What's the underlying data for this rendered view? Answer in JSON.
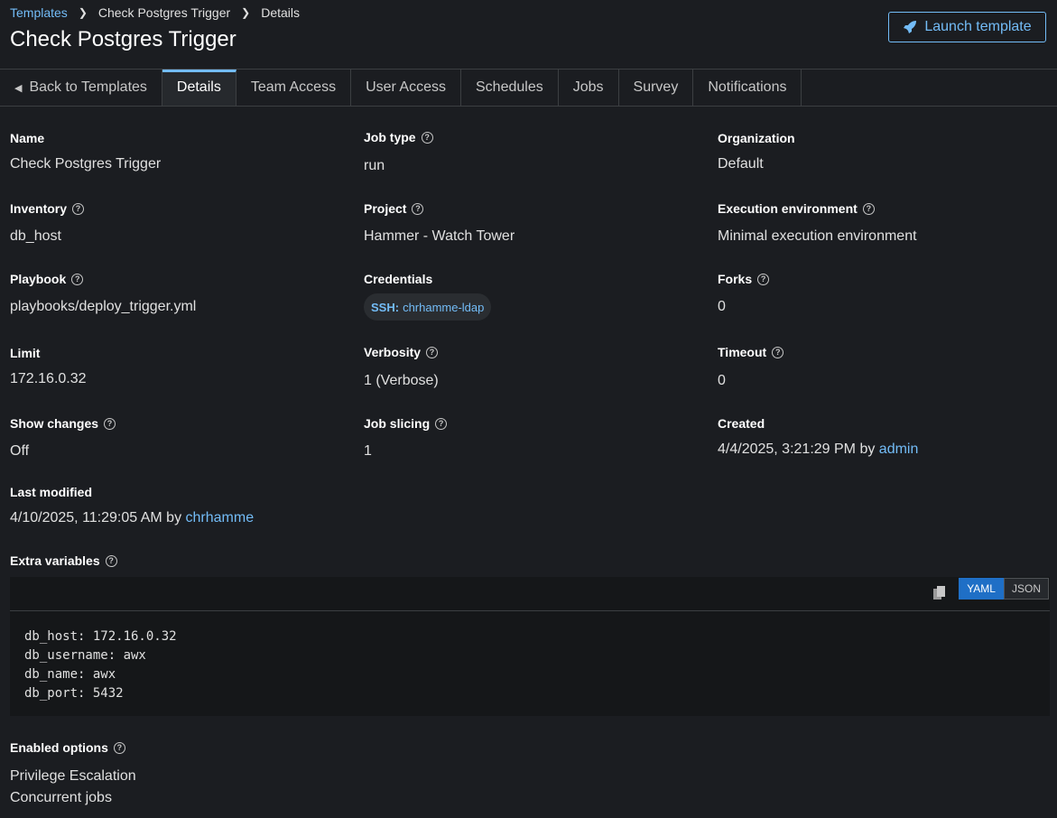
{
  "breadcrumb": {
    "templates": "Templates",
    "template": "Check Postgres Trigger",
    "current": "Details"
  },
  "title": "Check Postgres Trigger",
  "launch_label": "Launch template",
  "tabs": {
    "back": "Back to Templates",
    "details": "Details",
    "team": "Team Access",
    "user": "User Access",
    "schedules": "Schedules",
    "jobs": "Jobs",
    "survey": "Survey",
    "notifications": "Notifications"
  },
  "fields": {
    "name": {
      "label": "Name",
      "value": "Check Postgres Trigger"
    },
    "job_type": {
      "label": "Job type",
      "value": "run"
    },
    "organization": {
      "label": "Organization",
      "value": "Default"
    },
    "inventory": {
      "label": "Inventory",
      "value": "db_host"
    },
    "project": {
      "label": "Project",
      "value": "Hammer - Watch Tower"
    },
    "ee": {
      "label": "Execution environment",
      "value": "Minimal execution environment"
    },
    "playbook": {
      "label": "Playbook",
      "value": "playbooks/deploy_trigger.yml"
    },
    "credentials": {
      "label": "Credentials",
      "type": "SSH:",
      "value": "chrhamme-ldap"
    },
    "forks": {
      "label": "Forks",
      "value": "0"
    },
    "limit": {
      "label": "Limit",
      "value": "172.16.0.32"
    },
    "verbosity": {
      "label": "Verbosity",
      "value": "1 (Verbose)"
    },
    "timeout": {
      "label": "Timeout",
      "value": "0"
    },
    "show_changes": {
      "label": "Show changes",
      "value": "Off"
    },
    "job_slicing": {
      "label": "Job slicing",
      "value": "1"
    },
    "created": {
      "label": "Created",
      "value": "4/4/2025, 3:21:29 PM by",
      "user": "admin"
    },
    "modified": {
      "label": "Last modified",
      "value": "4/10/2025, 11:29:05 AM by",
      "user": "chrhamme"
    },
    "extra_vars": {
      "label": "Extra variables"
    },
    "enabled": {
      "label": "Enabled options",
      "opt1": "Privilege Escalation",
      "opt2": "Concurrent jobs"
    }
  },
  "code": {
    "yaml": "YAML",
    "json": "JSON",
    "text": "db_host: 172.16.0.32\ndb_username: awx\ndb_name: awx\ndb_port: 5432"
  },
  "colors": {
    "link": "#73bcf7",
    "active_toggle": "#1f6fc6"
  }
}
